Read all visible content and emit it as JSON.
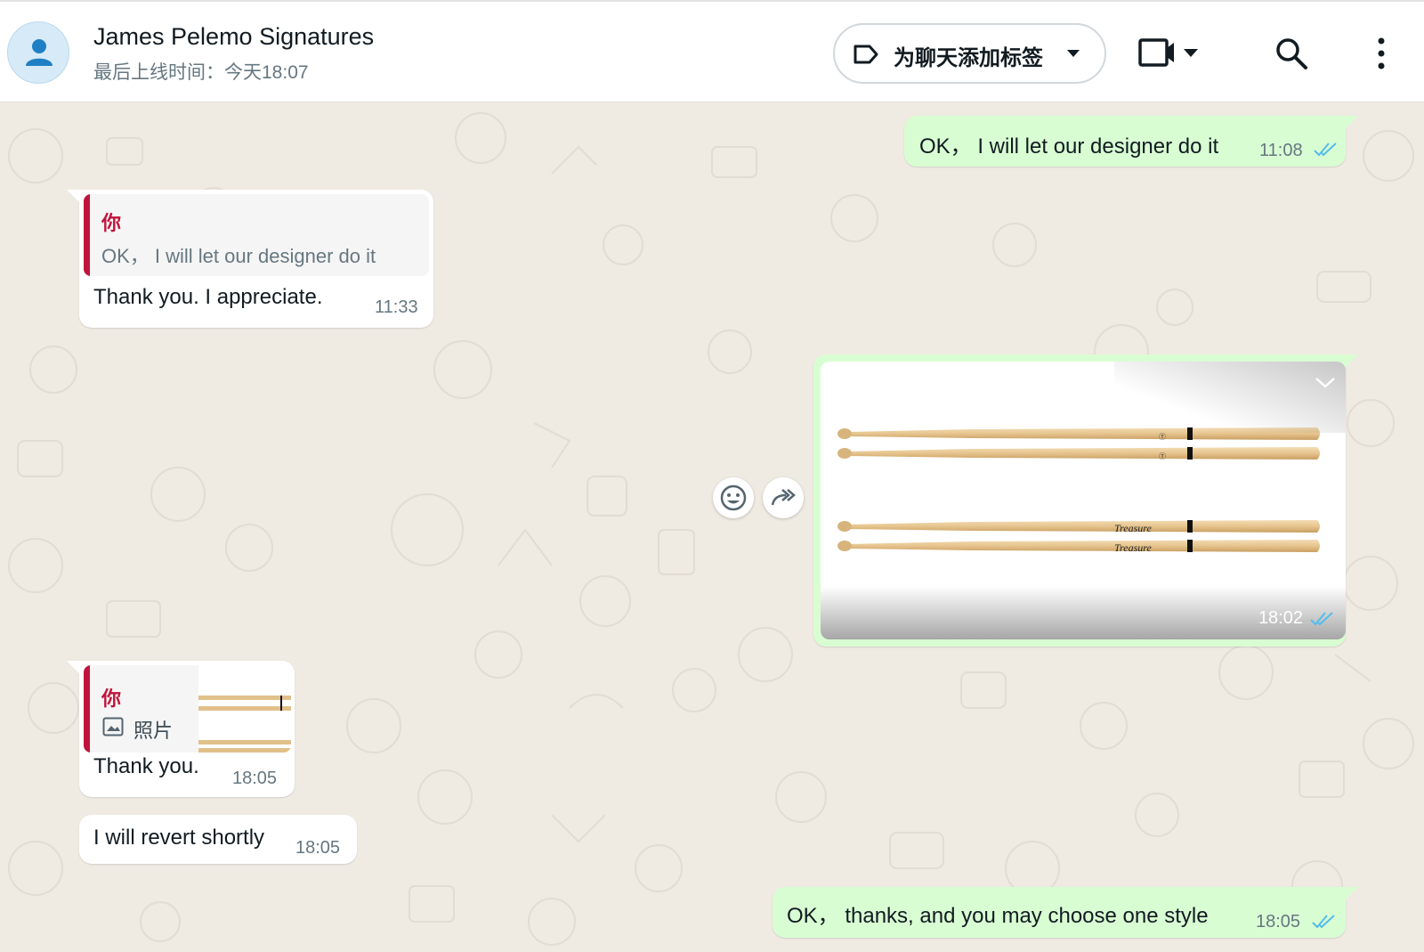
{
  "header": {
    "contact_name": "James Pelemo Signatures",
    "last_seen": "最后上线时间：今天18:07",
    "label_button": "为聊天添加标签"
  },
  "colors": {
    "outgoing_bubble": "#d9fdd3",
    "incoming_bubble": "#ffffff",
    "chat_background": "#efeae2",
    "read_ticks": "#53bdeb",
    "quote_accent": "#c0143c"
  },
  "messages": [
    {
      "direction": "out",
      "text": "OK，  I will let our designer do it",
      "time": "11:08",
      "status": "read"
    },
    {
      "direction": "in",
      "quote_author": "你",
      "quote_text": "OK，  I will let our designer do it",
      "text": "Thank you. I appreciate.",
      "time": "11:33"
    },
    {
      "direction": "out",
      "type": "image",
      "image_subject": "drumsticks",
      "brand_text": "Treasure",
      "time": "18:02",
      "status": "read"
    },
    {
      "direction": "in",
      "quote_author": "你",
      "quote_text": "照片",
      "text": "Thank you.",
      "time": "18:05"
    },
    {
      "direction": "in",
      "text": "I will revert shortly",
      "time": "18:05"
    },
    {
      "direction": "out",
      "text": "OK，  thanks, and you may choose one style",
      "time": "18:05",
      "status": "read"
    }
  ],
  "icons": {
    "avatar": "person-icon",
    "label": "tag-icon",
    "video": "video-camera-icon",
    "search": "search-icon",
    "menu": "more-vertical-icon",
    "react": "emoji-icon",
    "forward": "forward-icon",
    "image_menu": "chevron-down-icon",
    "quote_photo": "photo-icon"
  }
}
